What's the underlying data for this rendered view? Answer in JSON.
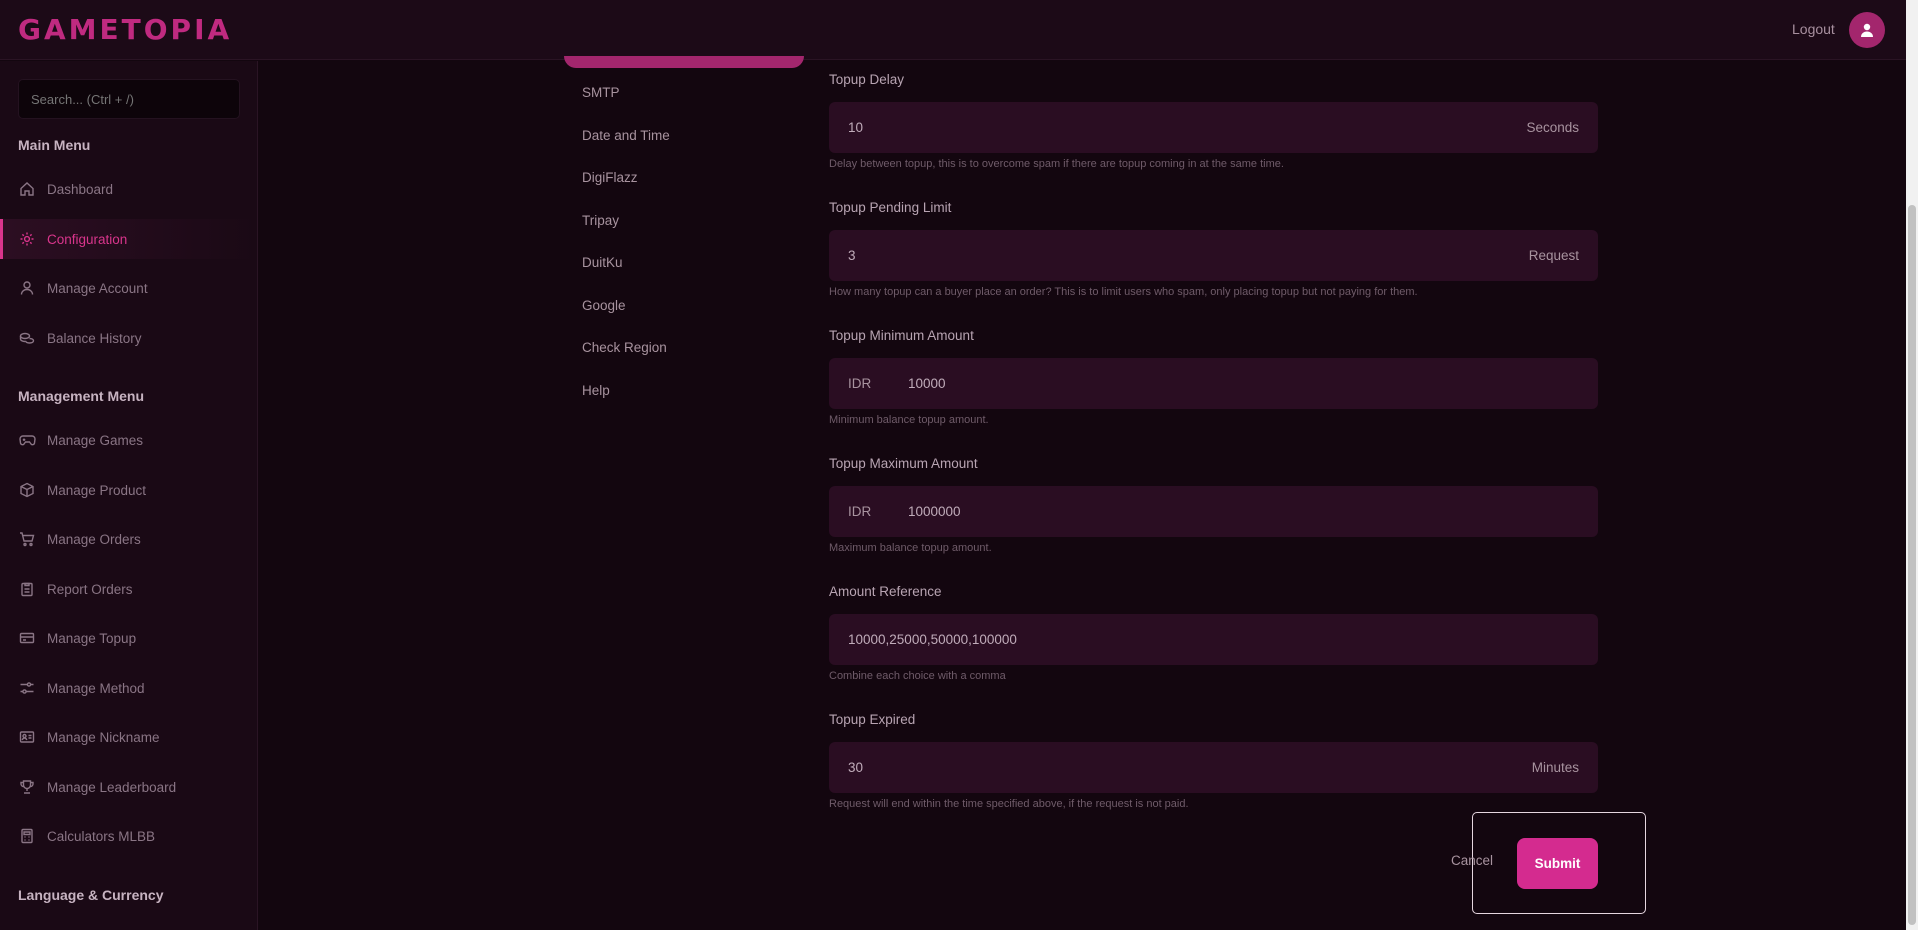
{
  "app": {
    "logo": "GAMETOPIA"
  },
  "header": {
    "logout_label": "Logout",
    "avatar_icon": "user-icon"
  },
  "sidebar": {
    "search_placeholder": "Search... (Ctrl + /)",
    "main_menu_title": "Main Menu",
    "main_menu": [
      {
        "label": "Dashboard",
        "icon": "home-icon"
      },
      {
        "label": "Configuration",
        "icon": "gear-icon",
        "active": true
      },
      {
        "label": "Manage Account",
        "icon": "user-icon"
      },
      {
        "label": "Balance History",
        "icon": "coins-icon"
      }
    ],
    "management_menu_title": "Management Menu",
    "management_menu": [
      {
        "label": "Manage Games",
        "icon": "gamepad-icon"
      },
      {
        "label": "Manage Product",
        "icon": "box-icon"
      },
      {
        "label": "Manage Orders",
        "icon": "cart-icon"
      },
      {
        "label": "Report Orders",
        "icon": "clipboard-icon"
      },
      {
        "label": "Manage Topup",
        "icon": "wallet-icon"
      },
      {
        "label": "Manage Method",
        "icon": "sliders-icon"
      },
      {
        "label": "Manage Nickname",
        "icon": "id-card-icon"
      },
      {
        "label": "Manage Leaderboard",
        "icon": "trophy-icon"
      },
      {
        "label": "Calculators MLBB",
        "icon": "calculator-icon"
      }
    ],
    "language_title": "Language & Currency"
  },
  "settings_nav": [
    "SMTP",
    "Date and Time",
    "DigiFlazz",
    "Tripay",
    "DuitKu",
    "Google",
    "Check Region",
    "Help"
  ],
  "form": {
    "topup_delay": {
      "label": "Topup Delay",
      "value": "10",
      "suffix": "Seconds",
      "help": "Delay between topup, this is to overcome spam if there are topup coming in at the same time."
    },
    "topup_pending_limit": {
      "label": "Topup Pending Limit",
      "value": "3",
      "suffix": "Request",
      "help": "How many topup can a buyer place an order? This is to limit users who spam, only placing topup but not paying for them."
    },
    "topup_minimum": {
      "label": "Topup Minimum Amount",
      "prefix": "IDR",
      "value": "10000",
      "help": "Minimum balance topup amount."
    },
    "topup_maximum": {
      "label": "Topup Maximum Amount",
      "prefix": "IDR",
      "value": "1000000",
      "help": "Maximum balance topup amount."
    },
    "amount_reference": {
      "label": "Amount Reference",
      "value": "10000,25000,50000,100000",
      "help": "Combine each choice with a comma"
    },
    "topup_expired": {
      "label": "Topup Expired",
      "value": "30",
      "suffix": "Minutes",
      "help": "Request will end within the time specified above, if the request is not paid."
    },
    "cancel_label": "Cancel",
    "submit_label": "Submit"
  },
  "colors": {
    "accent": "#d42b8f",
    "background": "#13060f",
    "field": "#2a0d22"
  }
}
